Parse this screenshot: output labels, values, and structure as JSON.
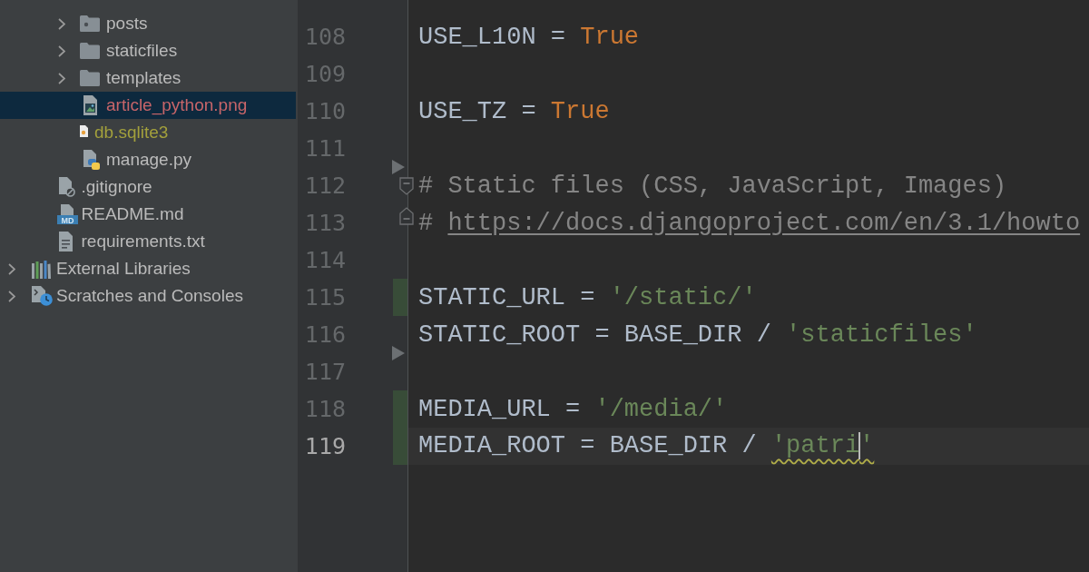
{
  "project_tree": [
    {
      "children": [
        {
          "children": [
            {
              "label": "posts",
              "kind": "package",
              "expanded": false,
              "selected": false,
              "color": "#bbbbbb"
            },
            {
              "label": "staticfiles",
              "kind": "folder",
              "expanded": false,
              "selected": false,
              "color": "#bbbbbb"
            },
            {
              "label": "templates",
              "kind": "folder",
              "expanded": false,
              "selected": false,
              "color": "#bbbbbb"
            },
            {
              "label": "article_python.png",
              "kind": "image",
              "selected": true,
              "color": "#c76569"
            },
            {
              "label": "db.sqlite3",
              "kind": "sqlite",
              "selected": false,
              "color": "#a3a03c"
            },
            {
              "label": "manage.py",
              "kind": "python",
              "selected": false,
              "color": "#bbbbbb"
            }
          ]
        },
        {
          "label": ".gitignore",
          "kind": "ignore",
          "selected": false,
          "color": "#bbbbbb"
        },
        {
          "label": "README.md",
          "kind": "markdown",
          "badge": "MD",
          "selected": false,
          "color": "#bbbbbb"
        },
        {
          "label": "requirements.txt",
          "kind": "text",
          "selected": false,
          "color": "#bbbbbb"
        }
      ]
    },
    {
      "label": "External Libraries",
      "kind": "libraries",
      "expanded": false,
      "selected": false,
      "color": "#bbbbbb"
    },
    {
      "label": "Scratches and Consoles",
      "kind": "scratches",
      "expanded": false,
      "selected": false,
      "color": "#bbbbbb"
    }
  ],
  "editor": {
    "lines": [
      {
        "number": "108",
        "current": false,
        "changed": false,
        "deleted_below": false,
        "tokens": [
          {
            "kind": "plain",
            "text": "USE_L10N = "
          },
          {
            "kind": "keyword",
            "text": "True"
          }
        ]
      },
      {
        "number": "109",
        "current": false,
        "changed": false,
        "deleted_below": false
      },
      {
        "number": "110",
        "current": false,
        "changed": false,
        "deleted_below": false,
        "tokens": [
          {
            "kind": "plain",
            "text": "USE_TZ = "
          },
          {
            "kind": "keyword",
            "text": "True"
          }
        ]
      },
      {
        "number": "111",
        "current": false,
        "changed": false,
        "deleted_below": true
      },
      {
        "number": "112",
        "current": false,
        "changed": false,
        "deleted_below": false,
        "fold": {
          "kind": "start"
        },
        "tokens": [
          {
            "kind": "comment",
            "text": "# Static files (CSS, JavaScript, Images)"
          }
        ]
      },
      {
        "number": "113",
        "current": false,
        "changed": false,
        "deleted_below": false,
        "fold": {
          "kind": "end"
        },
        "tokens": [
          {
            "kind": "comment",
            "text": "# "
          },
          {
            "kind": "link",
            "text": "https://docs.djangoproject.com/en/3.1/howto"
          }
        ]
      },
      {
        "number": "114",
        "current": false,
        "changed": false,
        "deleted_below": false
      },
      {
        "number": "115",
        "current": false,
        "changed": true,
        "deleted_below": false,
        "tokens": [
          {
            "kind": "plain",
            "text": "STATIC_URL = "
          },
          {
            "kind": "string",
            "text": "'/static/'",
            "typo": false
          }
        ]
      },
      {
        "number": "116",
        "current": false,
        "changed": false,
        "deleted_below": true,
        "tokens": [
          {
            "kind": "plain",
            "text": "STATIC_ROOT = BASE_DIR / "
          },
          {
            "kind": "string",
            "text": "'staticfiles'",
            "typo": false
          }
        ]
      },
      {
        "number": "117",
        "current": false,
        "changed": false,
        "deleted_below": false
      },
      {
        "number": "118",
        "current": false,
        "changed": true,
        "deleted_below": false,
        "tokens": [
          {
            "kind": "plain",
            "text": "MEDIA_URL = "
          },
          {
            "kind": "string",
            "text": "'/media/'",
            "typo": false
          }
        ]
      },
      {
        "number": "119",
        "current": true,
        "changed": true,
        "deleted_below": false,
        "tokens": [
          {
            "kind": "plain",
            "text": "MEDIA_ROOT = BASE_DIR / "
          },
          {
            "kind": "string",
            "text": "'patri",
            "typo": true
          },
          {
            "kind": "cursor"
          },
          {
            "kind": "string",
            "text": "'",
            "typo": true
          }
        ]
      }
    ]
  }
}
